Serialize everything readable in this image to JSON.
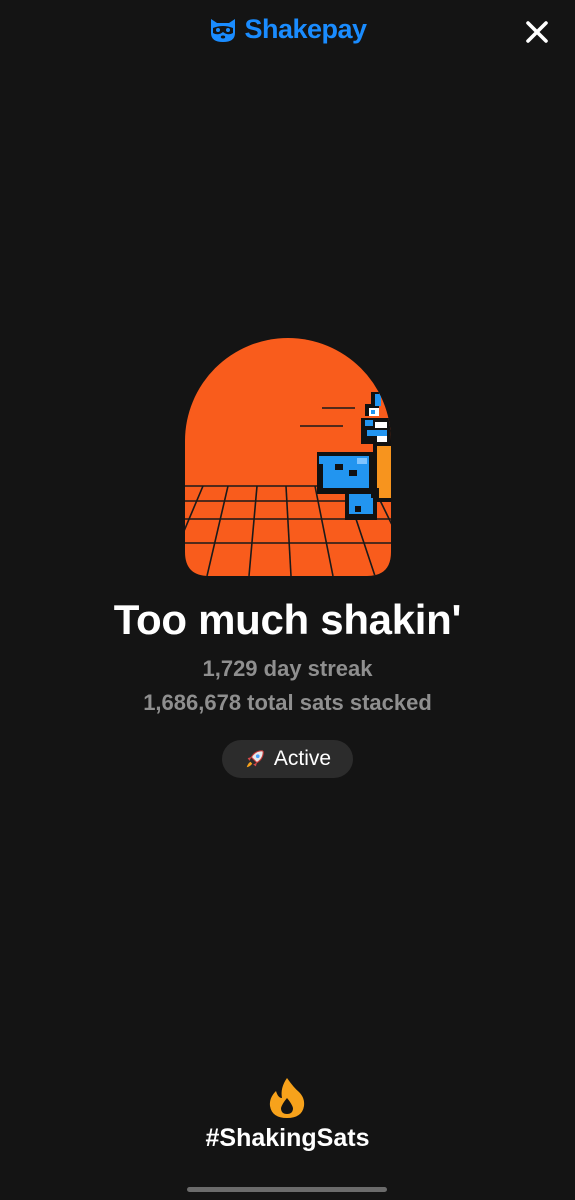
{
  "header": {
    "brand_name": "Shakepay",
    "brand_icon": "raccoon-logo-icon",
    "close_icon": "close-icon",
    "brand_color": "#1a8cff"
  },
  "badge": {
    "title": "Too much shakin'",
    "streak_text": "1,729 day streak",
    "sats_text": "1,686,678 total sats stacked",
    "art_colors": {
      "sun": "#f95c1c",
      "shirt": "#2295f0",
      "body": "#f7941e",
      "outline": "#111111"
    }
  },
  "status": {
    "icon": "rocket-icon",
    "label": "Active"
  },
  "footer": {
    "icon": "flame-icon",
    "hashtag": "#ShakingSats",
    "flame_color": "#f7a21b"
  }
}
